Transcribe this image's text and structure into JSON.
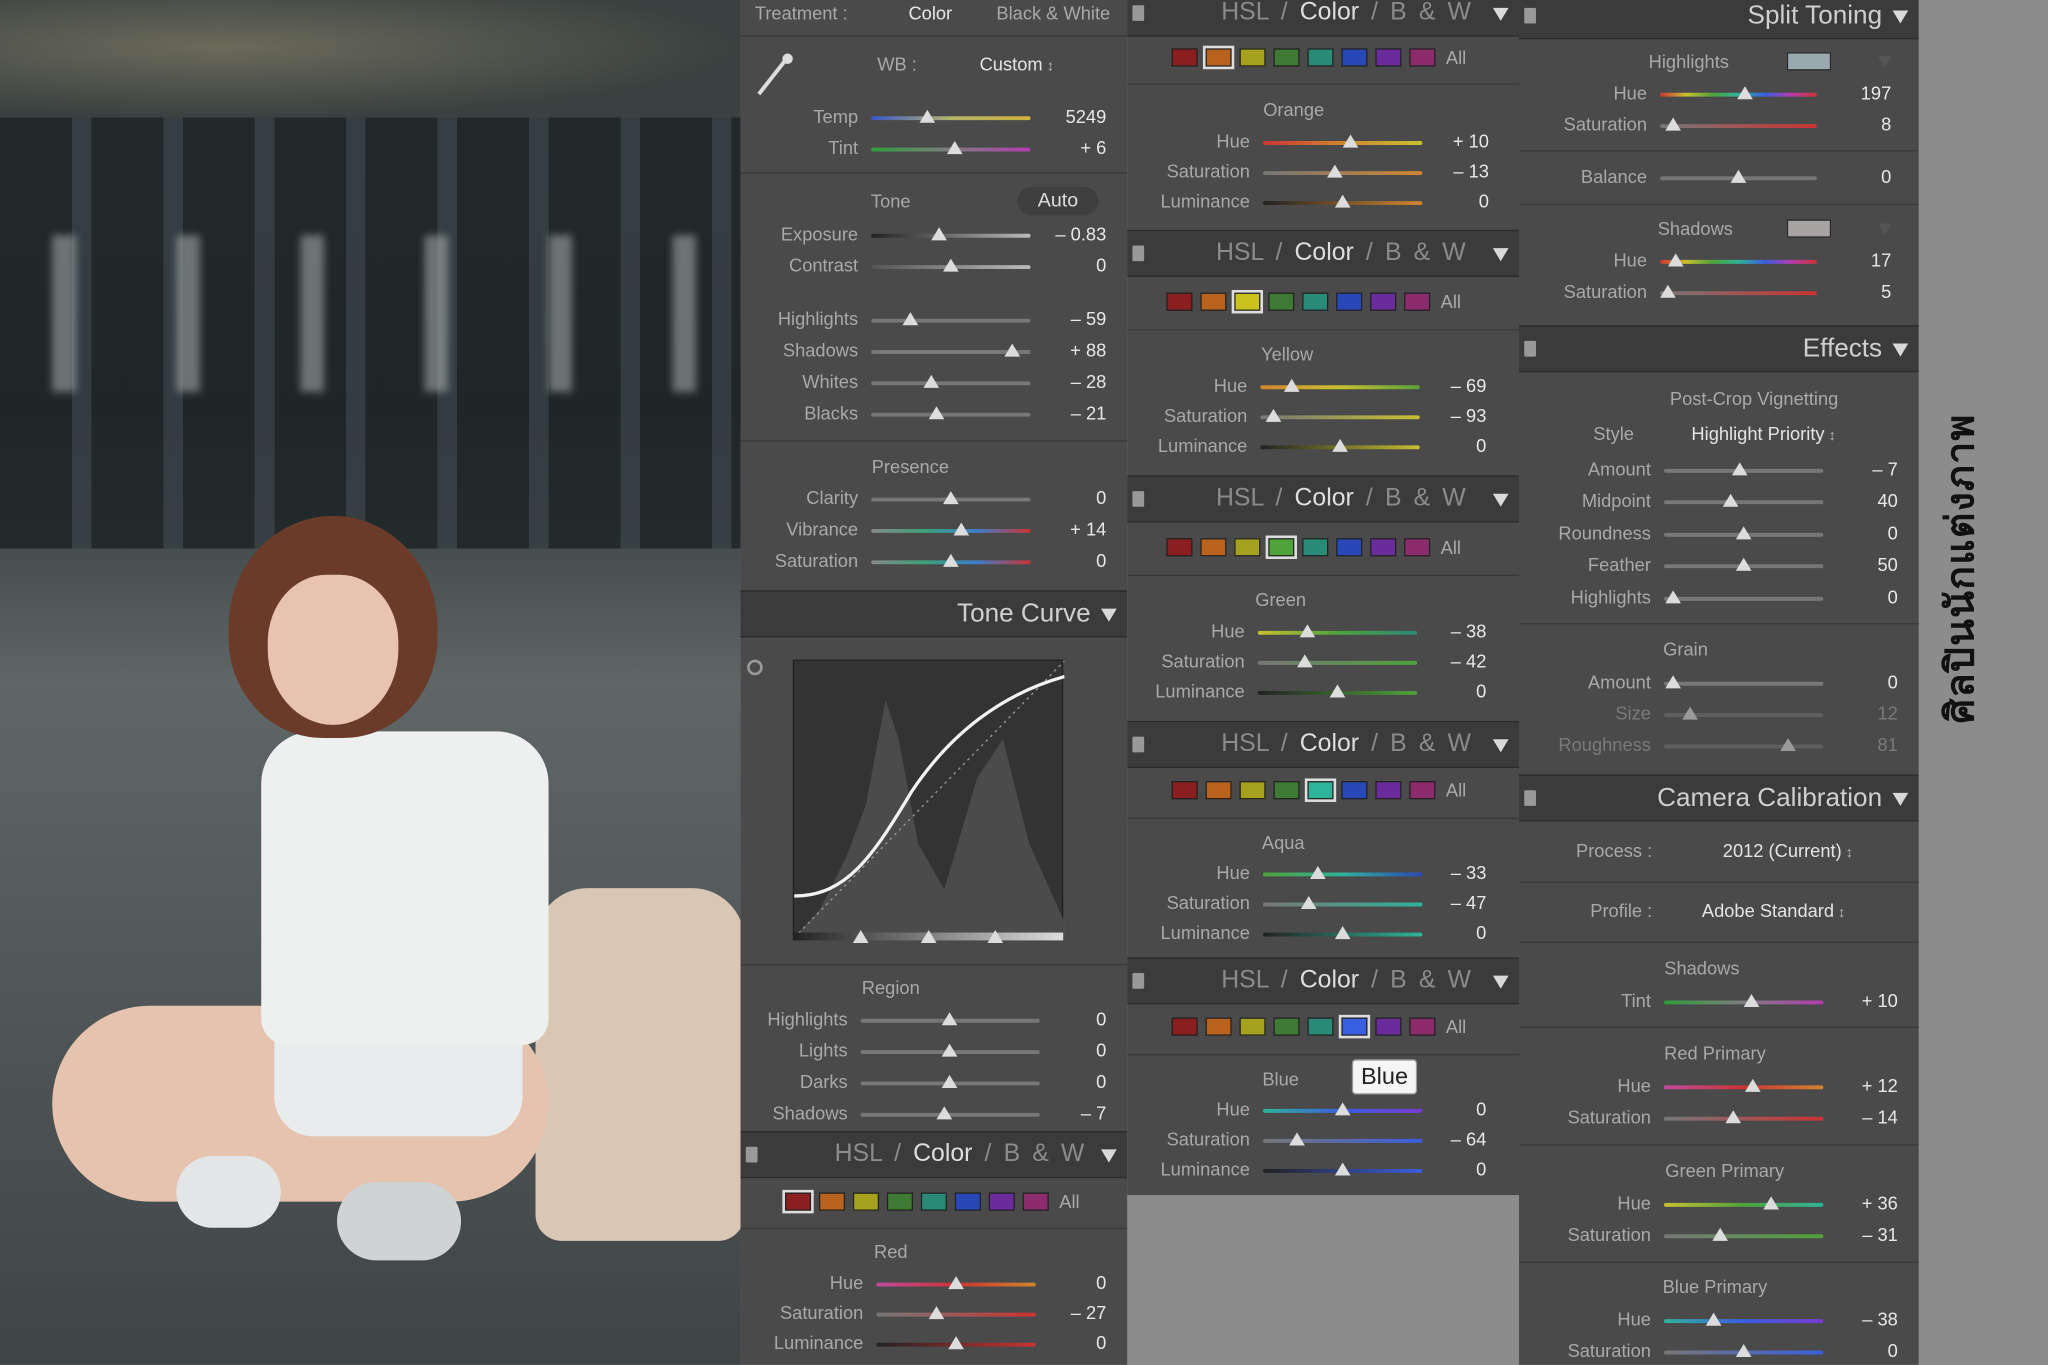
{
  "basic": {
    "treatment_label": "Treatment :",
    "treatment_color": "Color",
    "treatment_bw": "Black & White",
    "wb_label": "WB :",
    "wb_value": "Custom",
    "temp_label": "Temp",
    "temp_value": "5249",
    "tint_label": "Tint",
    "tint_value": "+ 6",
    "tone_label": "Tone",
    "auto_label": "Auto",
    "exposure_label": "Exposure",
    "exposure_value": "– 0.83",
    "contrast_label": "Contrast",
    "contrast_value": "0",
    "highlights_label": "Highlights",
    "highlights_value": "– 59",
    "shadows_label": "Shadows",
    "shadows_value": "+ 88",
    "whites_label": "Whites",
    "whites_value": "– 28",
    "blacks_label": "Blacks",
    "blacks_value": "– 21",
    "presence_label": "Presence",
    "clarity_label": "Clarity",
    "clarity_value": "0",
    "vibrance_label": "Vibrance",
    "vibrance_value": "+ 14",
    "saturation_label": "Saturation",
    "saturation_value": "0"
  },
  "tone_curve": {
    "title": "Tone Curve",
    "region_label": "Region",
    "highlights_label": "Highlights",
    "highlights_value": "0",
    "lights_label": "Lights",
    "lights_value": "0",
    "darks_label": "Darks",
    "darks_value": "0",
    "shadows_label": "Shadows",
    "shadows_value": "– 7"
  },
  "hsl_tabs": {
    "hsl": "HSL",
    "slash": "/",
    "color": "Color",
    "bw": "B & W",
    "all": "All"
  },
  "hsl_red": {
    "name": "Red",
    "hue_label": "Hue",
    "hue_value": "0",
    "sat_label": "Saturation",
    "sat_value": "– 27",
    "lum_label": "Luminance",
    "lum_value": "0"
  },
  "hsl_orange": {
    "name": "Orange",
    "hue_label": "Hue",
    "hue_value": "+ 10",
    "sat_label": "Saturation",
    "sat_value": "– 13",
    "lum_label": "Luminance",
    "lum_value": "0"
  },
  "hsl_yellow": {
    "name": "Yellow",
    "hue_label": "Hue",
    "hue_value": "– 69",
    "sat_label": "Saturation",
    "sat_value": "– 93",
    "lum_label": "Luminance",
    "lum_value": "0"
  },
  "hsl_green": {
    "name": "Green",
    "hue_label": "Hue",
    "hue_value": "– 38",
    "sat_label": "Saturation",
    "sat_value": "– 42",
    "lum_label": "Luminance",
    "lum_value": "0"
  },
  "hsl_aqua": {
    "name": "Aqua",
    "hue_label": "Hue",
    "hue_value": "– 33",
    "sat_label": "Saturation",
    "sat_value": "– 47",
    "lum_label": "Luminance",
    "lum_value": "0"
  },
  "hsl_blue": {
    "name": "Blue",
    "tooltip": "Blue",
    "hue_label": "Hue",
    "hue_value": "0",
    "sat_label": "Saturation",
    "sat_value": "– 64",
    "lum_label": "Luminance",
    "lum_value": "0"
  },
  "split": {
    "title": "Split Toning",
    "highlights_label": "Highlights",
    "hl_hue_label": "Hue",
    "hl_hue_value": "197",
    "hl_sat_label": "Saturation",
    "hl_sat_value": "8",
    "balance_label": "Balance",
    "balance_value": "0",
    "shadows_label": "Shadows",
    "sh_hue_label": "Hue",
    "sh_hue_value": "17",
    "sh_sat_label": "Saturation",
    "sh_sat_value": "5"
  },
  "effects": {
    "title": "Effects",
    "vignette_label": "Post-Crop Vignetting",
    "style_label": "Style",
    "style_value": "Highlight Priority",
    "amount_label": "Amount",
    "amount_value": "– 7",
    "midpoint_label": "Midpoint",
    "midpoint_value": "40",
    "roundness_label": "Roundness",
    "roundness_value": "0",
    "feather_label": "Feather",
    "feather_value": "50",
    "highlights_label": "Highlights",
    "highlights_value": "0",
    "grain_label": "Grain",
    "g_amount_label": "Amount",
    "g_amount_value": "0",
    "g_size_label": "Size",
    "g_size_value": "12",
    "g_rough_label": "Roughness",
    "g_rough_value": "81"
  },
  "calib": {
    "title": "Camera Calibration",
    "process_label": "Process :",
    "process_value": "2012 (Current)",
    "profile_label": "Profile :",
    "profile_value": "Adobe Standard",
    "shadows_label": "Shadows",
    "tint_label": "Tint",
    "tint_value": "+ 10",
    "red_label": "Red Primary",
    "red_hue_label": "Hue",
    "red_hue_value": "+ 12",
    "red_sat_label": "Saturation",
    "red_sat_value": "– 14",
    "green_label": "Green Primary",
    "green_hue_label": "Hue",
    "green_hue_value": "+ 36",
    "green_sat_label": "Saturation",
    "green_sat_value": "– 31",
    "blue_label": "Blue Primary",
    "blue_hue_label": "Hue",
    "blue_hue_value": "– 38",
    "blue_sat_label": "Saturation",
    "blue_sat_value": "0"
  },
  "side_text": "ศิลปินนักแต่งภาพ",
  "colors": {
    "panel_bg": "#4a4a4a",
    "bar_bg": "#3b3b3b",
    "value_text": "#e8e8e8",
    "label_text": "#a9a9a9",
    "swatch_red": "#8b1f1f",
    "swatch_orange": "#b8621d",
    "swatch_yellow": "#a7a21e",
    "swatch_green": "#3e7a33",
    "swatch_aqua": "#2a8a78",
    "swatch_blue": "#2948b8",
    "swatch_purple": "#6a2c9a",
    "swatch_magenta": "#8c2c6c"
  }
}
